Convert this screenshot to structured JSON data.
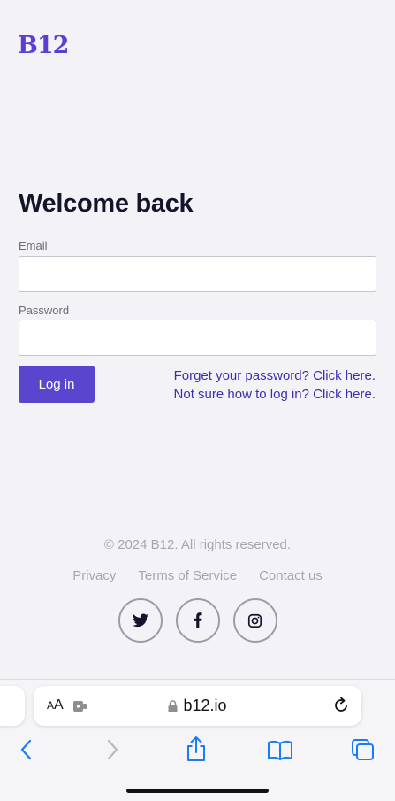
{
  "header": {
    "logo": "B12"
  },
  "form": {
    "title": "Welcome back",
    "email_label": "Email",
    "email_value": "",
    "password_label": "Password",
    "password_value": "",
    "login_label": "Log in",
    "forgot_link": "Forget your password? Click here.",
    "help_link": "Not sure how to log in? Click here."
  },
  "footer": {
    "copyright": "© 2024 B12. All rights reserved.",
    "links": [
      "Privacy",
      "Terms of Service",
      "Contact us"
    ],
    "socials": [
      "twitter-icon",
      "facebook-icon",
      "instagram-icon"
    ]
  },
  "browser": {
    "text_size_big": "A",
    "text_size_small": "A",
    "url": "b12.io",
    "toolbar_icons": [
      "back-icon",
      "forward-icon",
      "share-icon",
      "bookmarks-icon",
      "tabs-icon"
    ]
  },
  "colors": {
    "brand": "#5d3ed3",
    "button": "#5a45cf",
    "link": "#3b2fb0",
    "ios_blue": "#1b7cf2"
  }
}
